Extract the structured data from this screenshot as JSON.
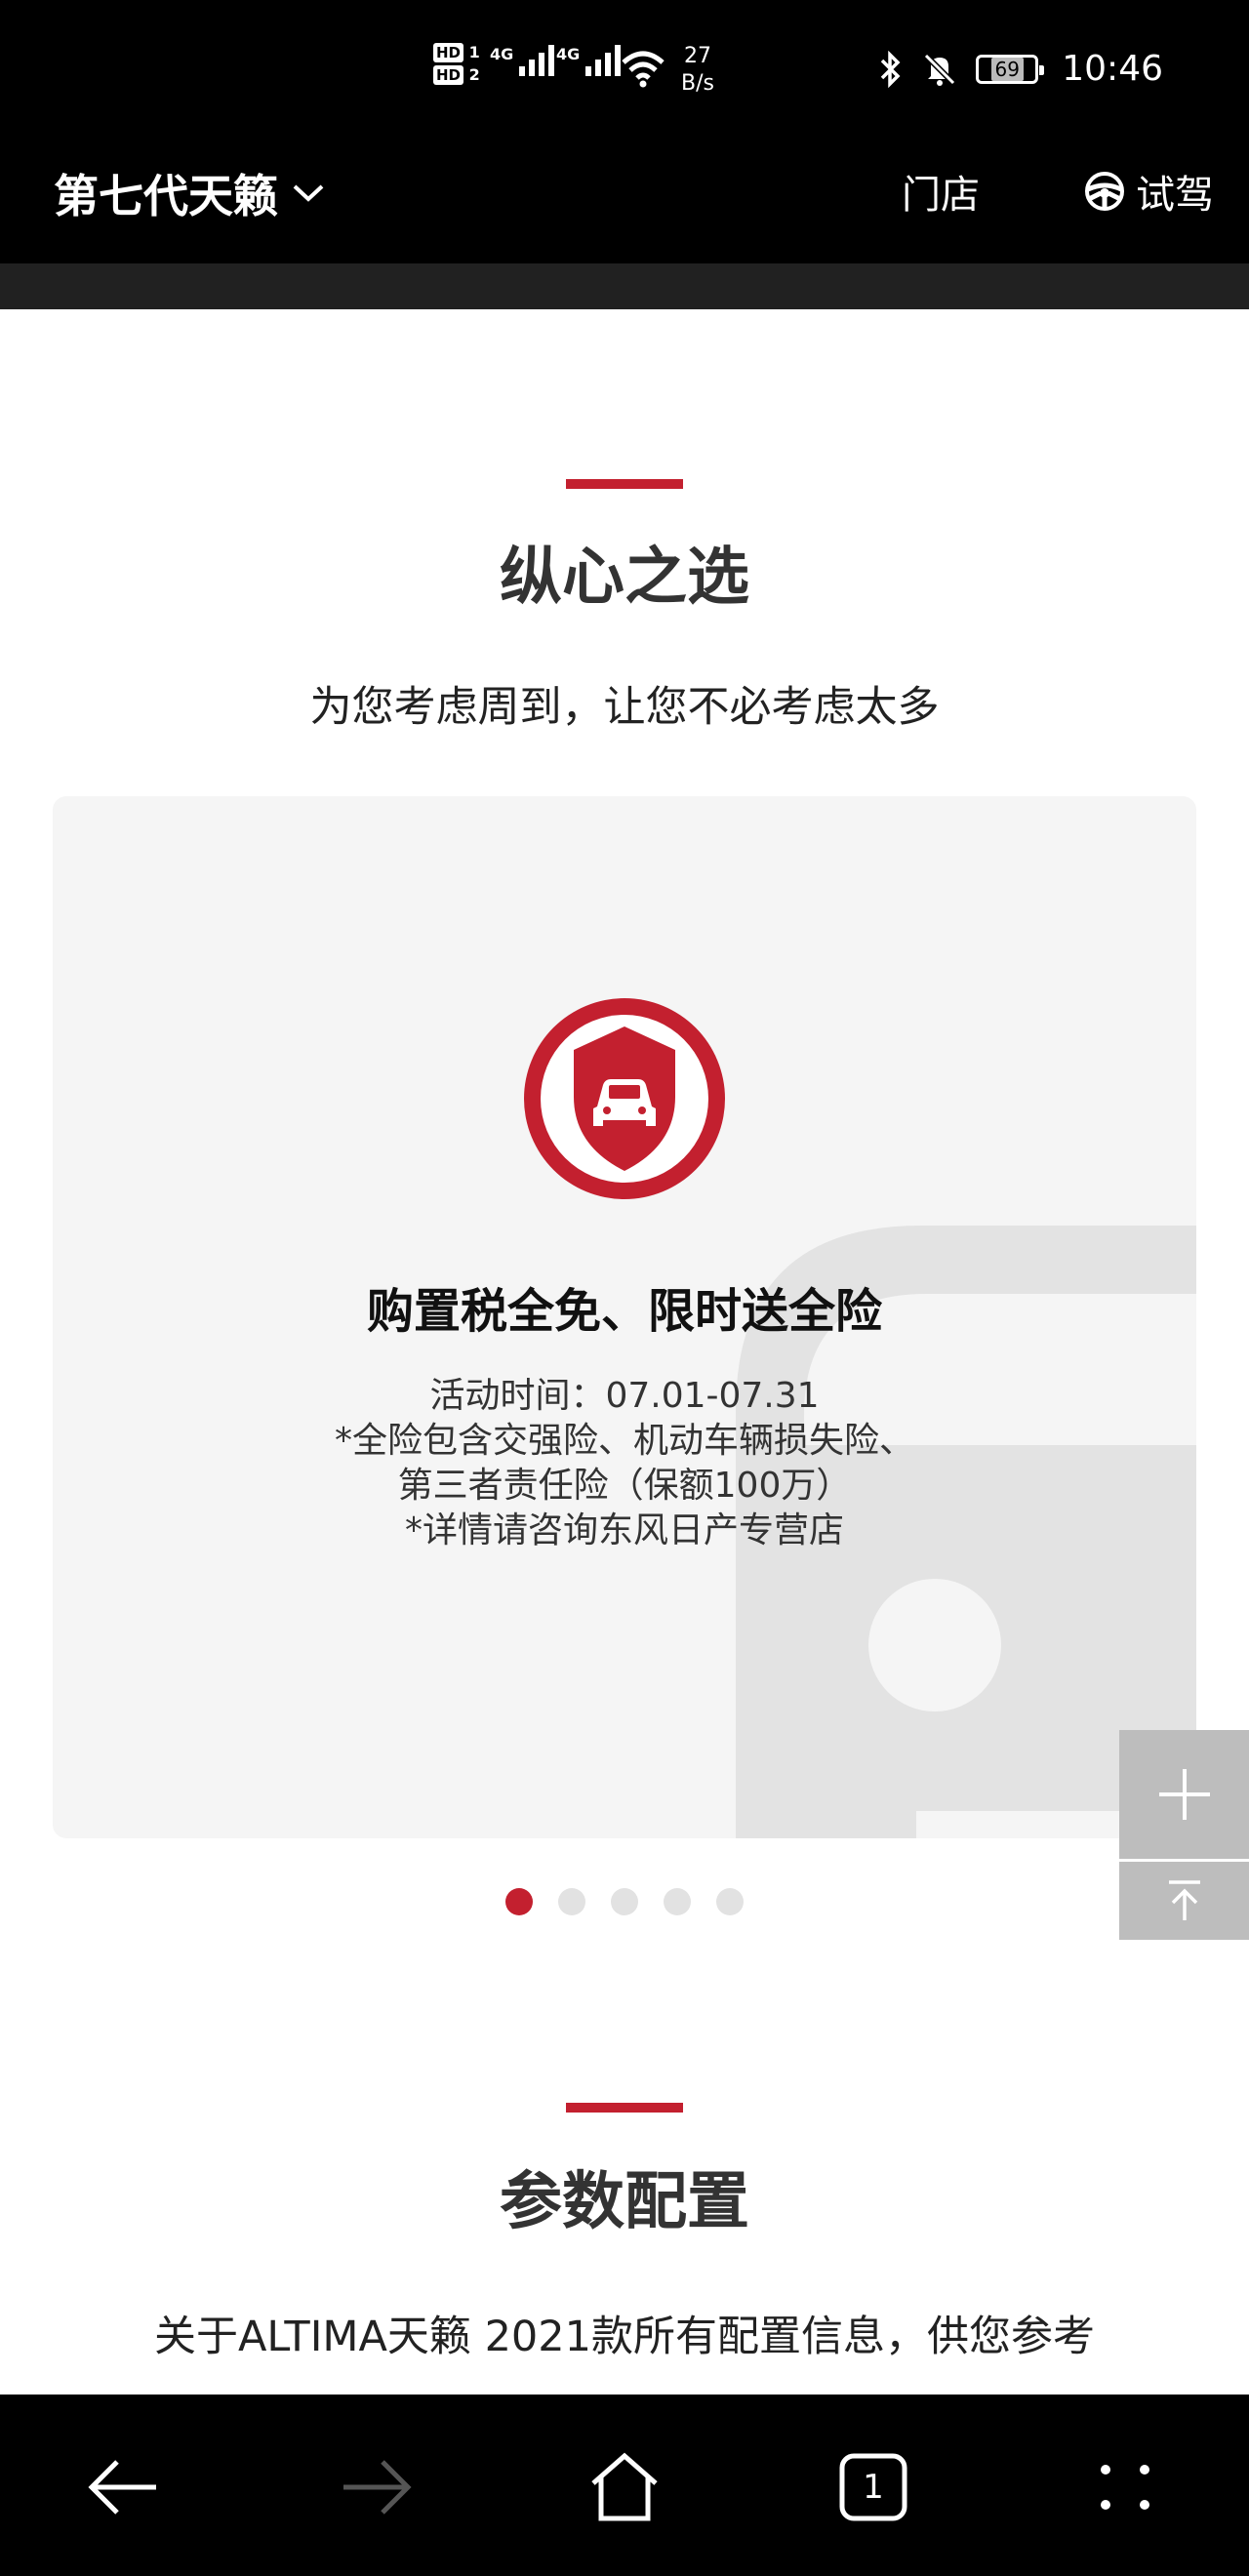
{
  "status_bar": {
    "sim1_label": "HD",
    "sim1_index": "1",
    "sim2_label": "HD",
    "sim2_index": "2",
    "network1": "4G",
    "network2": "4G",
    "speed_value": "27",
    "speed_unit": "B/s",
    "battery": "69",
    "time": "10:46"
  },
  "header": {
    "model_title": "第七代天籁",
    "store_label": "门店",
    "test_drive_label": "试驾"
  },
  "section1": {
    "title": "纵心之选",
    "subtitle": "为您考虑周到，让您不必考虑太多"
  },
  "card": {
    "heading": "购置税全免、限时送全险",
    "lines": [
      "活动时间：07.01-07.31",
      "*全险包含交强险、机动车辆损失险、",
      "第三者责任险（保额100万）",
      "*详情请咨询东风日产专营店"
    ]
  },
  "carousel": {
    "total": 5,
    "active_index": 0
  },
  "section2": {
    "title": "参数配置",
    "subtitle": "关于ALTIMA天籁 2021款所有配置信息，供您参考"
  },
  "bottom_nav": {
    "tab_count": "1"
  },
  "colors": {
    "accent": "#c3202f",
    "header_bg": "#000000",
    "card_bg": "#f5f5f5"
  }
}
